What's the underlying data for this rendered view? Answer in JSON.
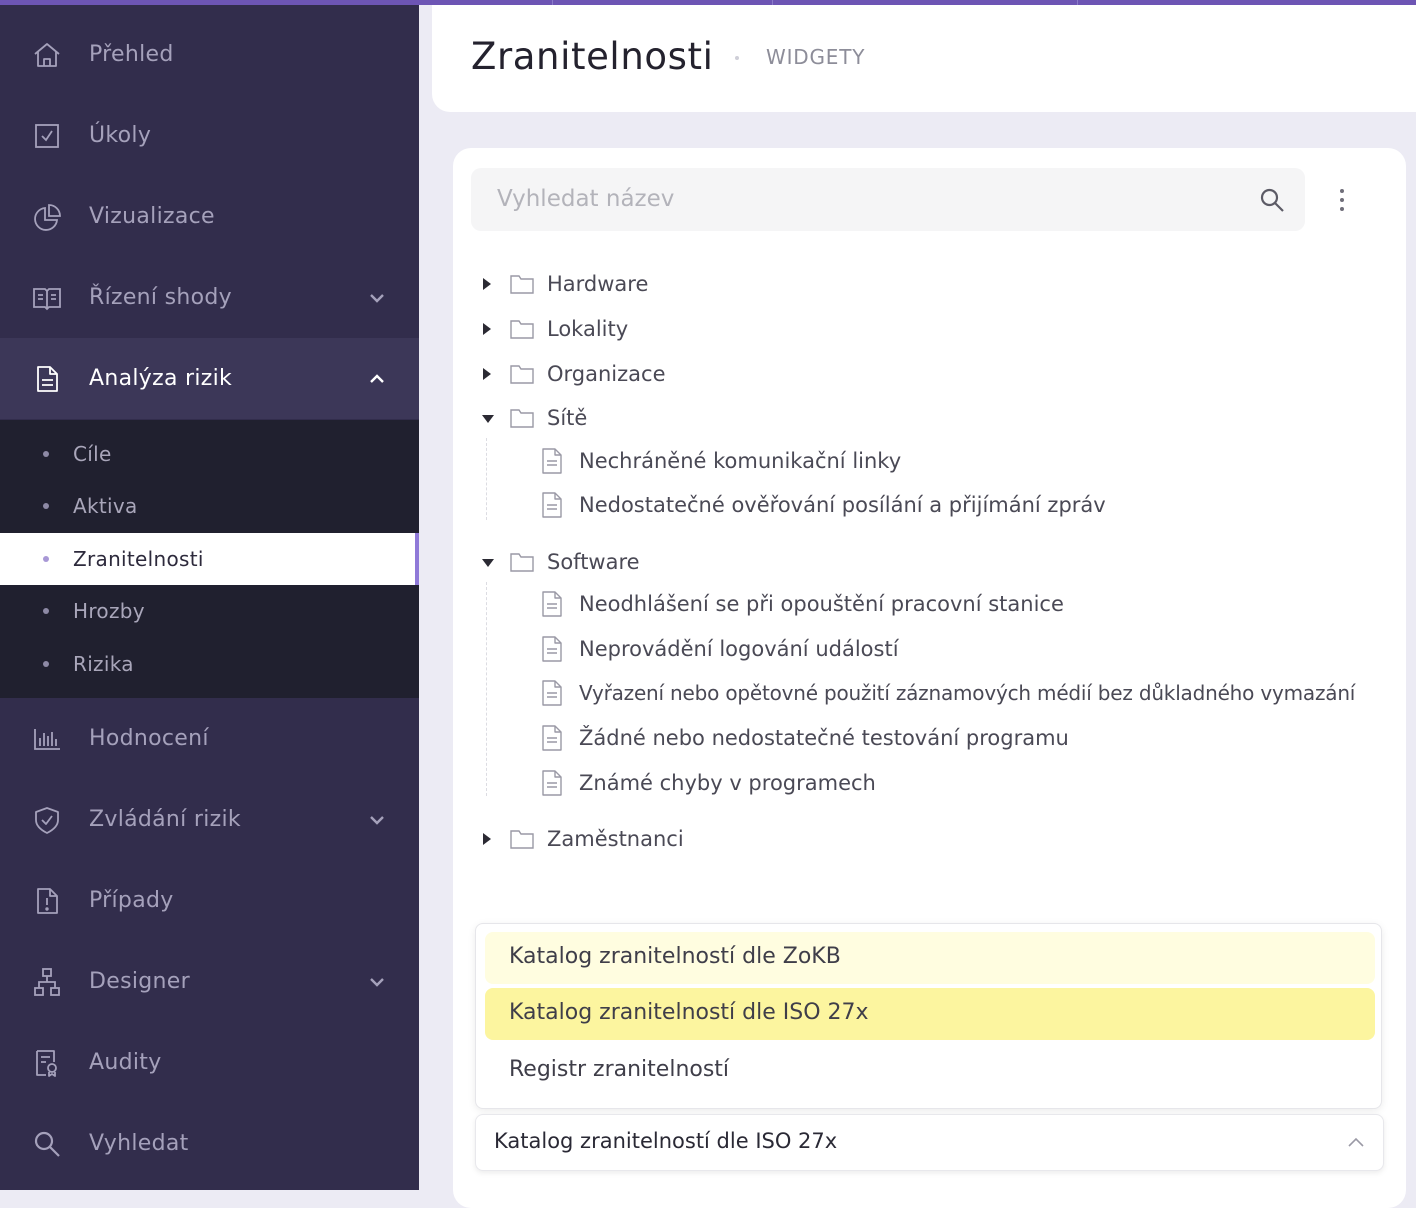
{
  "sidebar": {
    "items": [
      {
        "label": "Přehled",
        "icon": "home-icon"
      },
      {
        "label": "Úkoly",
        "icon": "checkbox-icon"
      },
      {
        "label": "Vizualizace",
        "icon": "pie-chart-icon"
      },
      {
        "label": "Řízení shody",
        "icon": "book-icon"
      },
      {
        "label": "Analýza rizik",
        "icon": "document-icon"
      },
      {
        "label": "Hodnocení",
        "icon": "bar-chart-icon"
      },
      {
        "label": "Zvládání rizik",
        "icon": "shield-icon"
      },
      {
        "label": "Případy",
        "icon": "alert-document-icon"
      },
      {
        "label": "Designer",
        "icon": "sitemap-icon"
      },
      {
        "label": "Audity",
        "icon": "audit-icon"
      },
      {
        "label": "Vyhledat",
        "icon": "search-icon"
      }
    ],
    "subitems": [
      "Cíle",
      "Aktiva",
      "Zranitelnosti",
      "Hrozby",
      "Rizika"
    ],
    "active_subitem": "Zranitelnosti"
  },
  "header": {
    "title": "Zranitelnosti",
    "subtitle": "WIDGETY"
  },
  "search": {
    "placeholder": "Vyhledat název"
  },
  "tree": {
    "folders": {
      "hardware": "Hardware",
      "lokality": "Lokality",
      "organizace": "Organizace",
      "site": "Sítě",
      "software": "Software",
      "zamestnanci": "Zaměstnanci"
    },
    "site_items": [
      "Nechráněné komunikační linky",
      "Nedostatečné ověřování posílání a přijímání zpráv"
    ],
    "software_items": [
      "Neodhlášení se při opouštění pracovní stanice",
      "Neprovádění logování událostí",
      "Vyřazení nebo opětovné použití záznamových médií bez důkladného vymazání",
      "Žádné nebo nedostatečné testování programu",
      "Známé chyby v programech"
    ]
  },
  "catalog": {
    "options": [
      "Katalog zranitelností dle ZoKB",
      "Katalog zranitelností dle ISO 27x",
      "Registr zranitelností"
    ],
    "selected": "Katalog zranitelností dle ISO 27x"
  },
  "colors": {
    "sidebar_bg": "#322d4c",
    "subnav_bg": "#20202f",
    "accent": "#8f79d8",
    "option_hover": "#fffde0",
    "option_selected": "#fcf59f"
  }
}
